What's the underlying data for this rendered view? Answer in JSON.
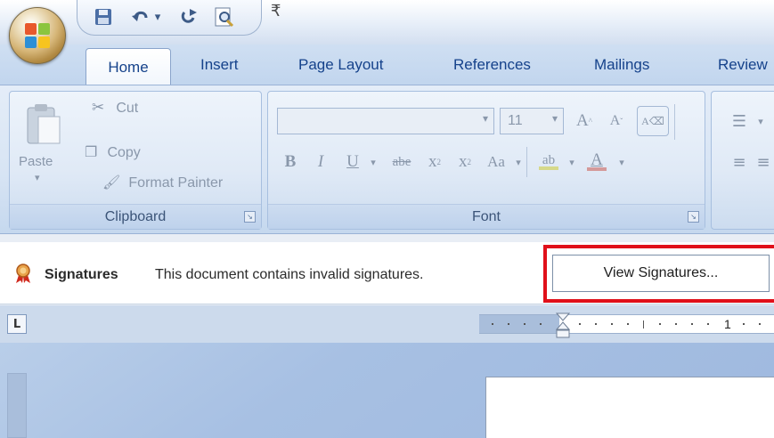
{
  "quick_access": {
    "items": [
      {
        "icon": "save-icon"
      },
      {
        "icon": "undo-icon",
        "dropdown": "▾"
      },
      {
        "icon": "redo-icon"
      },
      {
        "icon": "print-preview-icon"
      }
    ],
    "customize_glyph": "₹"
  },
  "tabs": [
    "Home",
    "Insert",
    "Page Layout",
    "References",
    "Mailings",
    "Review"
  ],
  "ribbon": {
    "clipboard": {
      "label": "Clipboard",
      "paste": "Paste",
      "cut": "Cut",
      "copy": "Copy",
      "format_painter": "Format Painter"
    },
    "font": {
      "label": "Font",
      "font_name": "",
      "font_size": "11",
      "grow": "A",
      "shrink": "A",
      "bold": "B",
      "italic": "I",
      "underline": "U",
      "strike": "abe",
      "subscript": "x",
      "superscript": "x",
      "change_case": "Aa",
      "highlight": "ab",
      "font_color": "A"
    }
  },
  "message_bar": {
    "title": "Signatures",
    "text": "This document contains invalid signatures.",
    "button": "View Signatures...",
    "highlight_color": "#e0101a"
  },
  "ruler": {
    "number": "1",
    "tab_selector": "L"
  },
  "colors": {
    "tab_text": "#15428b",
    "ribbon_bg": "#d7e4f4"
  }
}
